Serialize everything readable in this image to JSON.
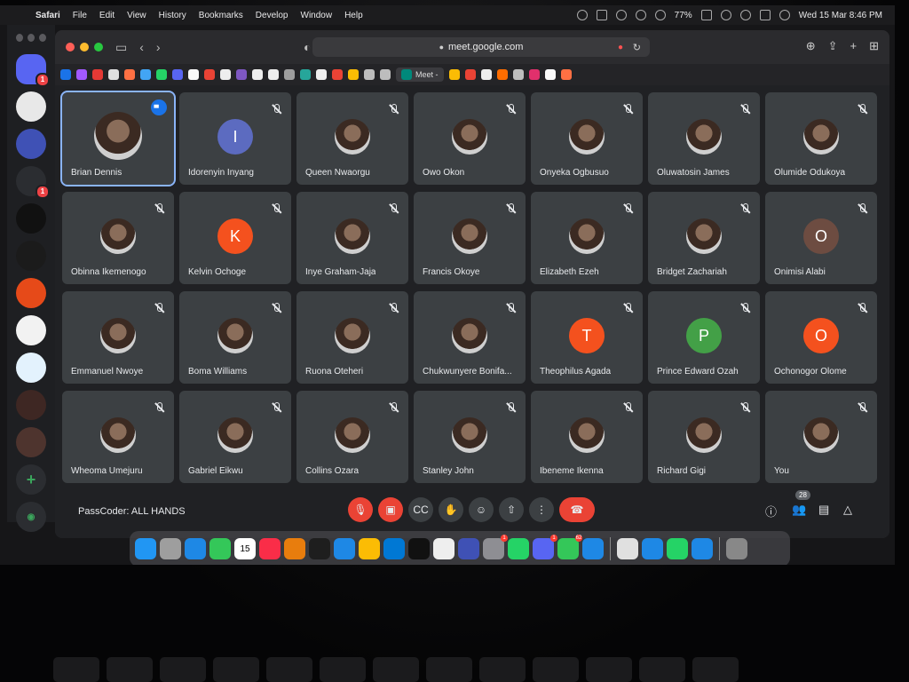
{
  "menubar": {
    "app": "Safari",
    "menus": [
      "File",
      "Edit",
      "View",
      "History",
      "Bookmarks",
      "Develop",
      "Window",
      "Help"
    ],
    "battery": "77%",
    "datetime": "Wed 15 Mar  8:46 PM"
  },
  "discord": {
    "badges": [
      "1",
      "1"
    ]
  },
  "safari": {
    "url": "meet.google.com",
    "active_tab_label": "Meet -"
  },
  "meet": {
    "meeting_title": "PassCoder: ALL HANDS",
    "participant_count": "28",
    "participants": [
      {
        "name": "Brian Dennis",
        "initial": "",
        "color": "",
        "speaking": true
      },
      {
        "name": "Idorenyin Inyang",
        "initial": "I",
        "color": "#5c6bc0"
      },
      {
        "name": "Queen Nwaorgu",
        "initial": "",
        "color": ""
      },
      {
        "name": "Owo Okon",
        "initial": "",
        "color": ""
      },
      {
        "name": "Onyeka Ogbusuo",
        "initial": "",
        "color": ""
      },
      {
        "name": "Oluwatosin James",
        "initial": "",
        "color": ""
      },
      {
        "name": "Olumide Odukoya",
        "initial": "",
        "color": ""
      },
      {
        "name": "Obinna Ikemenogo",
        "initial": "",
        "color": ""
      },
      {
        "name": "Kelvin Ochoge",
        "initial": "K",
        "color": "#f4511e"
      },
      {
        "name": "Inye Graham-Jaja",
        "initial": "",
        "color": ""
      },
      {
        "name": "Francis Okoye",
        "initial": "",
        "color": ""
      },
      {
        "name": "Elizabeth Ezeh",
        "initial": "",
        "color": ""
      },
      {
        "name": "Bridget Zachariah",
        "initial": "",
        "color": ""
      },
      {
        "name": "Onimisi Alabi",
        "initial": "O",
        "color": "#6d4c41"
      },
      {
        "name": "Emmanuel Nwoye",
        "initial": "",
        "color": ""
      },
      {
        "name": "Boma Williams",
        "initial": "",
        "color": ""
      },
      {
        "name": "Ruona Oteheri",
        "initial": "",
        "color": ""
      },
      {
        "name": "Chukwunyere Bonifa...",
        "initial": "",
        "color": ""
      },
      {
        "name": "Theophilus Agada",
        "initial": "T",
        "color": "#f4511e"
      },
      {
        "name": "Prince Edward Ozah",
        "initial": "P",
        "color": "#43a047"
      },
      {
        "name": "Ochonogor Olome",
        "initial": "O",
        "color": "#f4511e"
      },
      {
        "name": "Wheoma Umejuru",
        "initial": "",
        "color": ""
      },
      {
        "name": "Gabriel Eikwu",
        "initial": "",
        "color": ""
      },
      {
        "name": "Collins Ozara",
        "initial": "",
        "color": ""
      },
      {
        "name": "Stanley John",
        "initial": "",
        "color": ""
      },
      {
        "name": "Ibeneme Ikenna",
        "initial": "",
        "color": ""
      },
      {
        "name": "Richard Gigi",
        "initial": "",
        "color": ""
      },
      {
        "name": "You",
        "initial": "",
        "color": ""
      }
    ]
  },
  "dock": {
    "calendar_day": "15",
    "badges": [
      "1",
      "1",
      "62"
    ]
  }
}
